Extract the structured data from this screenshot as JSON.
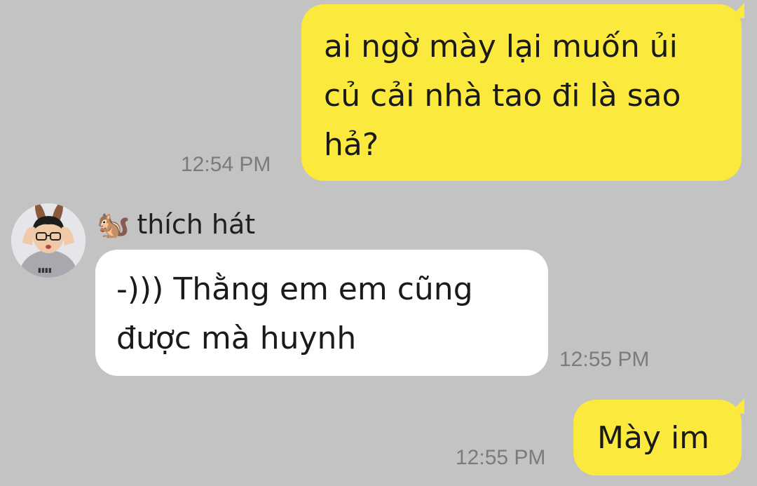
{
  "colors": {
    "background": "#c3c3c3",
    "outgoing_bubble": "#fce93d",
    "incoming_bubble": "#ffffff",
    "timestamp": "#7b7b7b"
  },
  "messages": [
    {
      "direction": "outgoing",
      "lines": [
        "ai ngờ mày lại muốn ủi",
        "củ cải nhà tao đi là sao",
        "hả?"
      ],
      "time": "12:54 PM"
    },
    {
      "direction": "incoming",
      "sender": {
        "emoji": "🐿️",
        "name": "thích hát",
        "avatar_icon": "avatar-photo-icon"
      },
      "lines": [
        "-))) Thằng em em cũng",
        "được mà huynh"
      ],
      "time": "12:55 PM"
    },
    {
      "direction": "outgoing",
      "lines": [
        "Mày im"
      ],
      "time": "12:55 PM"
    }
  ]
}
